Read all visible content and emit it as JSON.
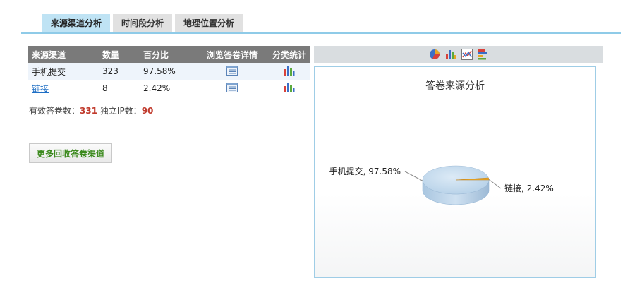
{
  "tabs": [
    {
      "label": "来源渠道分析",
      "active": true
    },
    {
      "label": "时间段分析",
      "active": false
    },
    {
      "label": "地理位置分析",
      "active": false
    }
  ],
  "table": {
    "headers": {
      "source": "来源渠道",
      "count": "数量",
      "percent": "百分比",
      "browse": "浏览答卷详情",
      "stats": "分类统计"
    },
    "rows": [
      {
        "source": "手机提交",
        "count": "323",
        "percent": "97.58%"
      },
      {
        "source": "链接",
        "count": "8",
        "percent": "2.42%"
      }
    ]
  },
  "summary": {
    "valid_label": "有效答卷数：",
    "valid_value": "331",
    "ip_label": "独立IP数：",
    "ip_value": "90"
  },
  "more_button_label": "更多回收答卷渠道",
  "toolbar_icons": [
    "pie-chart-icon",
    "bar-chart-icon",
    "line-chart-icon",
    "horizontal-bar-chart-icon"
  ],
  "chart_data": {
    "type": "pie",
    "title": "答卷来源分析",
    "slices": [
      {
        "label": "手机提交",
        "value": 97.58,
        "display": "手机提交, 97.58%",
        "color": "#b9d4ea"
      },
      {
        "label": "链接",
        "value": 2.42,
        "display": "链接, 2.42%",
        "color": "#e8a524"
      }
    ]
  },
  "colors": {
    "tab_active": "#bfe3f4",
    "header_bg": "#7a7a7a",
    "link": "#1f6fc5",
    "highlight_num": "#c0392b",
    "more_button_text": "#3c8a1e"
  }
}
